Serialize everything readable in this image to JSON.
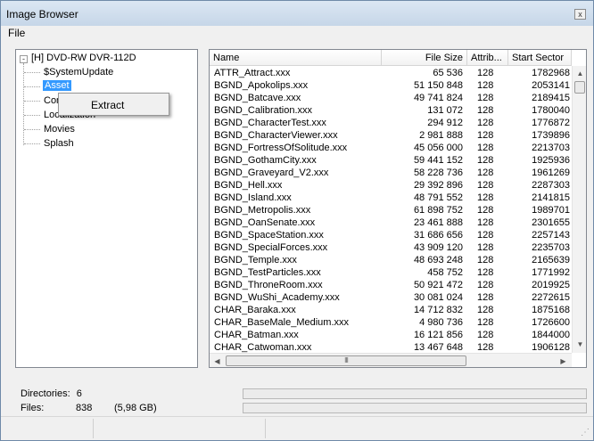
{
  "window": {
    "title": "Image Browser",
    "close_glyph": "x"
  },
  "menu": {
    "file_label": "File"
  },
  "tree": {
    "root": "[H] DVD-RW  DVR-112D",
    "expander": "-",
    "children": [
      {
        "label": "$SystemUpdate",
        "selected": false
      },
      {
        "label": "Asset",
        "selected": true
      },
      {
        "label": "Com",
        "selected": false
      },
      {
        "label": "Localization",
        "selected": false
      },
      {
        "label": "Movies",
        "selected": false
      },
      {
        "label": "Splash",
        "selected": false
      }
    ]
  },
  "context_menu": {
    "items": [
      "Extract"
    ]
  },
  "table": {
    "columns": [
      "Name",
      "File Size",
      "Attrib...",
      "Start Sector"
    ],
    "rows": [
      [
        "ATTR_Attract.xxx",
        "65 536",
        "128",
        "1782968"
      ],
      [
        "BGND_Apokolips.xxx",
        "51 150 848",
        "128",
        "2053141"
      ],
      [
        "BGND_Batcave.xxx",
        "49 741 824",
        "128",
        "2189415"
      ],
      [
        "BGND_Calibration.xxx",
        "131 072",
        "128",
        "1780040"
      ],
      [
        "BGND_CharacterTest.xxx",
        "294 912",
        "128",
        "1776872"
      ],
      [
        "BGND_CharacterViewer.xxx",
        "2 981 888",
        "128",
        "1739896"
      ],
      [
        "BGND_FortressOfSolitude.xxx",
        "45 056 000",
        "128",
        "2213703"
      ],
      [
        "BGND_GothamCity.xxx",
        "59 441 152",
        "128",
        "1925936"
      ],
      [
        "BGND_Graveyard_V2.xxx",
        "58 228 736",
        "128",
        "1961269"
      ],
      [
        "BGND_Hell.xxx",
        "29 392 896",
        "128",
        "2287303"
      ],
      [
        "BGND_Island.xxx",
        "48 791 552",
        "128",
        "2141815"
      ],
      [
        "BGND_Metropolis.xxx",
        "61 898 752",
        "128",
        "1989701"
      ],
      [
        "BGND_OanSenate.xxx",
        "23 461 888",
        "128",
        "2301655"
      ],
      [
        "BGND_SpaceStation.xxx",
        "31 686 656",
        "128",
        "2257143"
      ],
      [
        "BGND_SpecialForces.xxx",
        "43 909 120",
        "128",
        "2235703"
      ],
      [
        "BGND_Temple.xxx",
        "48 693 248",
        "128",
        "2165639"
      ],
      [
        "BGND_TestParticles.xxx",
        "458 752",
        "128",
        "1771992"
      ],
      [
        "BGND_ThroneRoom.xxx",
        "50 921 472",
        "128",
        "2019925"
      ],
      [
        "BGND_WuShi_Academy.xxx",
        "30 081 024",
        "128",
        "2272615"
      ],
      [
        "CHAR_Baraka.xxx",
        "14 712 832",
        "128",
        "1875168"
      ],
      [
        "CHAR_BaseMale_Medium.xxx",
        "4 980 736",
        "128",
        "1726600"
      ],
      [
        "CHAR_Batman.xxx",
        "16 121 856",
        "128",
        "1844000"
      ],
      [
        "CHAR_Catwoman.xxx",
        "13 467 648",
        "128",
        "1906128"
      ]
    ],
    "scroll_up": "▲",
    "scroll_down": "▼",
    "scroll_left": "◀",
    "scroll_right": "▶",
    "thumb_grip": "III"
  },
  "stats": {
    "directories_label": "Directories:",
    "directories_value": "6",
    "files_label": "Files:",
    "files_value": "838",
    "files_size": "(5,98 GB)"
  },
  "colors": {
    "selection": "#3399ff",
    "titlebar": "#c6d6e8"
  }
}
